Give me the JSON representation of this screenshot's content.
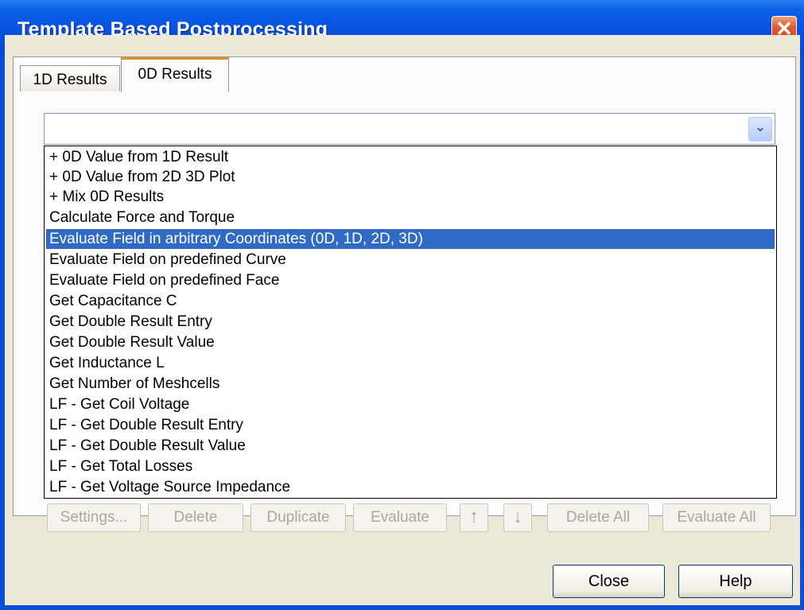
{
  "window": {
    "title": "Template Based Postprocessing",
    "close_glyph": "✕"
  },
  "tabs": [
    {
      "label": "1D Results",
      "active": false
    },
    {
      "label": "0D Results",
      "active": true
    }
  ],
  "combo": {
    "value": "",
    "arrow_icon": "chevron-down-icon",
    "arrow_glyph": "⌄"
  },
  "dropdown_items": [
    "+ 0D Value from 1D Result",
    "+ 0D Value from 2D 3D Plot",
    "+ Mix 0D Results",
    "Calculate Force and Torque",
    "Evaluate Field in arbitrary Coordinates (0D, 1D, 2D, 3D)",
    "Evaluate Field on predefined Curve",
    "Evaluate Field on predefined Face",
    "Get Capacitance C",
    "Get Double Result Entry",
    "Get Double Result Value",
    "Get Inductance L",
    "Get Number of Meshcells",
    "LF - Get Coil Voltage",
    "LF - Get Double Result Entry",
    "LF - Get Double Result Value",
    "LF - Get Total Losses",
    "LF - Get Voltage Source Impedance"
  ],
  "selected_item": "Evaluate Field in arbitrary Coordinates (0D, 1D, 2D, 3D)",
  "action_buttons": {
    "settings": "Settings...",
    "delete": "Delete",
    "duplicate": "Duplicate",
    "evaluate": "Evaluate",
    "move_up_glyph": "↑",
    "move_down_glyph": "↓",
    "delete_all": "Delete All",
    "evaluate_all": "Evaluate All"
  },
  "footer": {
    "close": "Close",
    "help": "Help"
  },
  "colors": {
    "titlebar": "#0751df",
    "selection": "#316ac5",
    "dialog_bg": "#ece9d8",
    "active_tab_accent": "#e68b2c"
  }
}
